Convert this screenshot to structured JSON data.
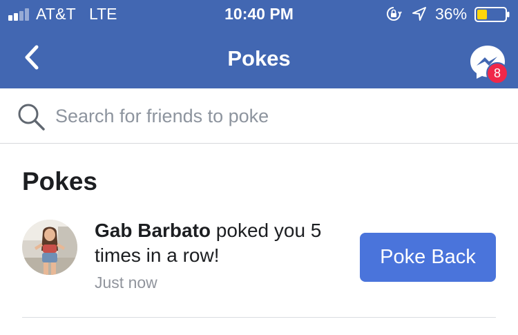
{
  "status_bar": {
    "carrier": "AT&T",
    "network": "LTE",
    "time": "10:40 PM",
    "battery_percent": "36%",
    "battery_level": 0.36,
    "battery_color": "#ffd60a",
    "icons": [
      "signal-icon",
      "orientation-lock-icon",
      "location-arrow-icon",
      "battery-icon"
    ]
  },
  "nav": {
    "title": "Pokes",
    "back_icon": "chevron-left-icon",
    "messenger_icon": "messenger-icon",
    "messenger_badge": "8"
  },
  "search": {
    "placeholder": "Search for friends to poke",
    "value": "",
    "icon": "search-icon"
  },
  "section": {
    "title": "Pokes"
  },
  "pokes": [
    {
      "name": "Gab Barbato",
      "message": " poked you 5 times in a row!",
      "time": "Just now",
      "button_label": "Poke Back"
    }
  ],
  "colors": {
    "brand_blue": "#4267b2",
    "button_blue": "#4a74db",
    "badge_red": "#f02849"
  }
}
